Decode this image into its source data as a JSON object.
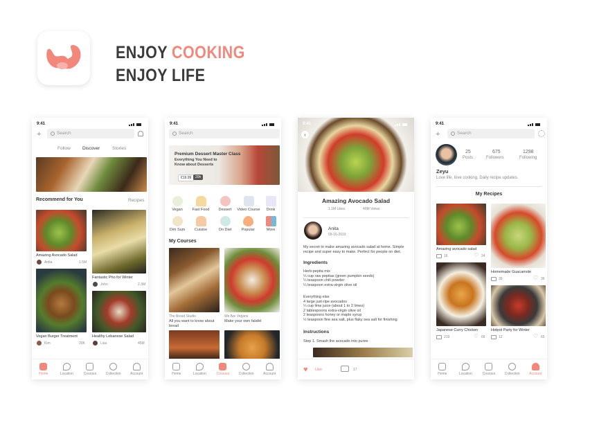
{
  "hero": {
    "line1_a": "ENJOY ",
    "line1_b": "COOKING",
    "line2": "ENJOY LIFE"
  },
  "status_time": "9:41",
  "search_placeholder": "Search",
  "tabs": [
    "Home",
    "Location",
    "Courses",
    "Collection",
    "Account"
  ],
  "screen1": {
    "top_tabs": [
      "Follow",
      "Discover",
      "Stories"
    ],
    "section_title": "Recommend for You",
    "section_link": "Recipes",
    "cards": [
      {
        "title": "Amazing Avocado Salad",
        "author": "Anita",
        "count": "1.5M"
      },
      {
        "title": "Fantastic Pho for Winter",
        "author": "John",
        "count": "2.3M"
      },
      {
        "title": "Vegan Burger Treatment",
        "author": "Kim",
        "count": "20K"
      },
      {
        "title": "Healthy Lebanese Salad",
        "author": "Lisa",
        "count": "45M"
      }
    ]
  },
  "screen2": {
    "banner_title": "Premium Dessert Master Class",
    "banner_sub": "Everything You Need to Know about Desserts",
    "banner_price": "€19.99",
    "banner_tag": "20h",
    "categories": [
      "Vegan",
      "Fast Food",
      "Dessert",
      "Video Course",
      "Drink",
      "Dim Sum",
      "Cuisine",
      "On Diet",
      "Popular",
      "More"
    ],
    "section_title": "My Courses",
    "courses": [
      {
        "author": "The Bread Studio",
        "title": "All you want to know about bread"
      },
      {
        "author": "We Are Vegans",
        "title": "Make your own falafel"
      }
    ]
  },
  "screen3": {
    "title": "Amazing Avocado Salad",
    "likes": "1.1M Likes",
    "views": "40M Views",
    "author": "Anita",
    "date": "09-16-2019",
    "description": "My secret to make amazing avocado salad at home. Simple recipe and super easy to make. Perfect for people on diet.",
    "ingredients_title": "Ingredients",
    "ingredients_1": "Herb-pepita mix\n⅓ cup raw pepitas (green pumpkin seeds)\n¼ teaspoon chili powder\n¼ teaspoon extra-virgin olive oil",
    "ingredients_2": "Everything else\n4 large just-ripe avocados\n¼ cup lime juice (about 1 to 2 limes)\n2 tablespoons extra-virgin olive oil\n2 teaspoons honey or maple syrup\n½ teaspoon fine sea salt, plus flaky sea salt for finishing",
    "instructions_title": "Instructions",
    "step1": "Step 1. Smash the avocado into puree",
    "like_label": "Like",
    "comments": "17"
  },
  "screen4": {
    "stats": [
      {
        "value": "25",
        "label": "Posts"
      },
      {
        "value": "675",
        "label": "Followers"
      },
      {
        "value": "1298",
        "label": "Following"
      }
    ],
    "name": "Zeyu",
    "bio": "Love life, love cooking. Daily recipe updates.",
    "section_title": "My Recipes",
    "recipes": [
      {
        "title": "Amazing avocado salad",
        "comments": "16",
        "likes": "24"
      },
      {
        "title": "Homemade Guacamole",
        "comments": "39",
        "likes": "36"
      },
      {
        "title": "Japanese Curry Chicken",
        "comments": "219",
        "likes": "66"
      },
      {
        "title": "Hotpot Party for Winter",
        "comments": "12",
        "likes": "65"
      }
    ]
  },
  "colors": {
    "accent": "#f2877c",
    "text": "#3a3a3a"
  }
}
